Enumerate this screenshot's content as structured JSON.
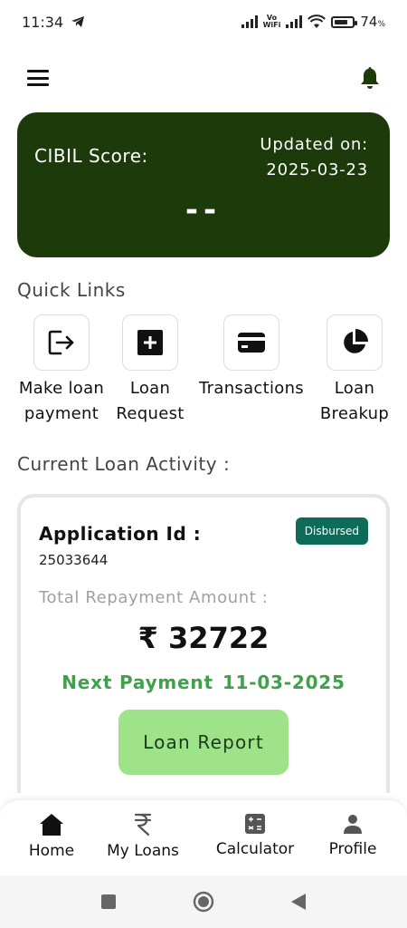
{
  "status_bar": {
    "time": "11:34",
    "vowifi_top": "Vo",
    "vowifi_bottom": "WiFi",
    "battery_level": 0.74,
    "battery_percent": "74",
    "battery_unit": "%"
  },
  "top_bar": {
    "menu_icon": "hamburger-icon",
    "notification_icon": "bell-icon"
  },
  "cibil": {
    "label": "CIBIL Score:",
    "updated_label": "Updated on:",
    "updated_date": "2025-03-23",
    "score": "--"
  },
  "quick_links": {
    "title": "Quick Links",
    "items": [
      {
        "label": "Make loan\npayment",
        "icon": "logout-arrow-icon"
      },
      {
        "label": "Loan\nRequest",
        "icon": "plus-square-icon"
      },
      {
        "label": "Transactions",
        "icon": "credit-card-icon"
      },
      {
        "label": "Loan\nBreakup",
        "icon": "pie-chart-icon"
      }
    ]
  },
  "loan_activity": {
    "title": "Current Loan Activity :",
    "application_id_label": "Application Id :",
    "application_id": "25033644",
    "status": "Disbursed",
    "repayment_label": "Total Repayment Amount :",
    "repayment_amount": "₹ 32722",
    "next_payment_label": "Next Payment",
    "next_payment_date": "11-03-2025",
    "report_button": "Loan Report"
  },
  "bottom_nav": {
    "items": [
      {
        "label": "Home",
        "icon": "home-icon"
      },
      {
        "label": "My Loans",
        "icon": "rupee-icon"
      },
      {
        "label": "Calculator",
        "icon": "calculator-icon"
      },
      {
        "label": "Profile",
        "icon": "person-icon"
      }
    ]
  },
  "colors": {
    "cibil_bg": "#1c3a0a",
    "badge": "#0f6b59",
    "next_payment": "#3fa14a",
    "button": "#9ee38a"
  }
}
